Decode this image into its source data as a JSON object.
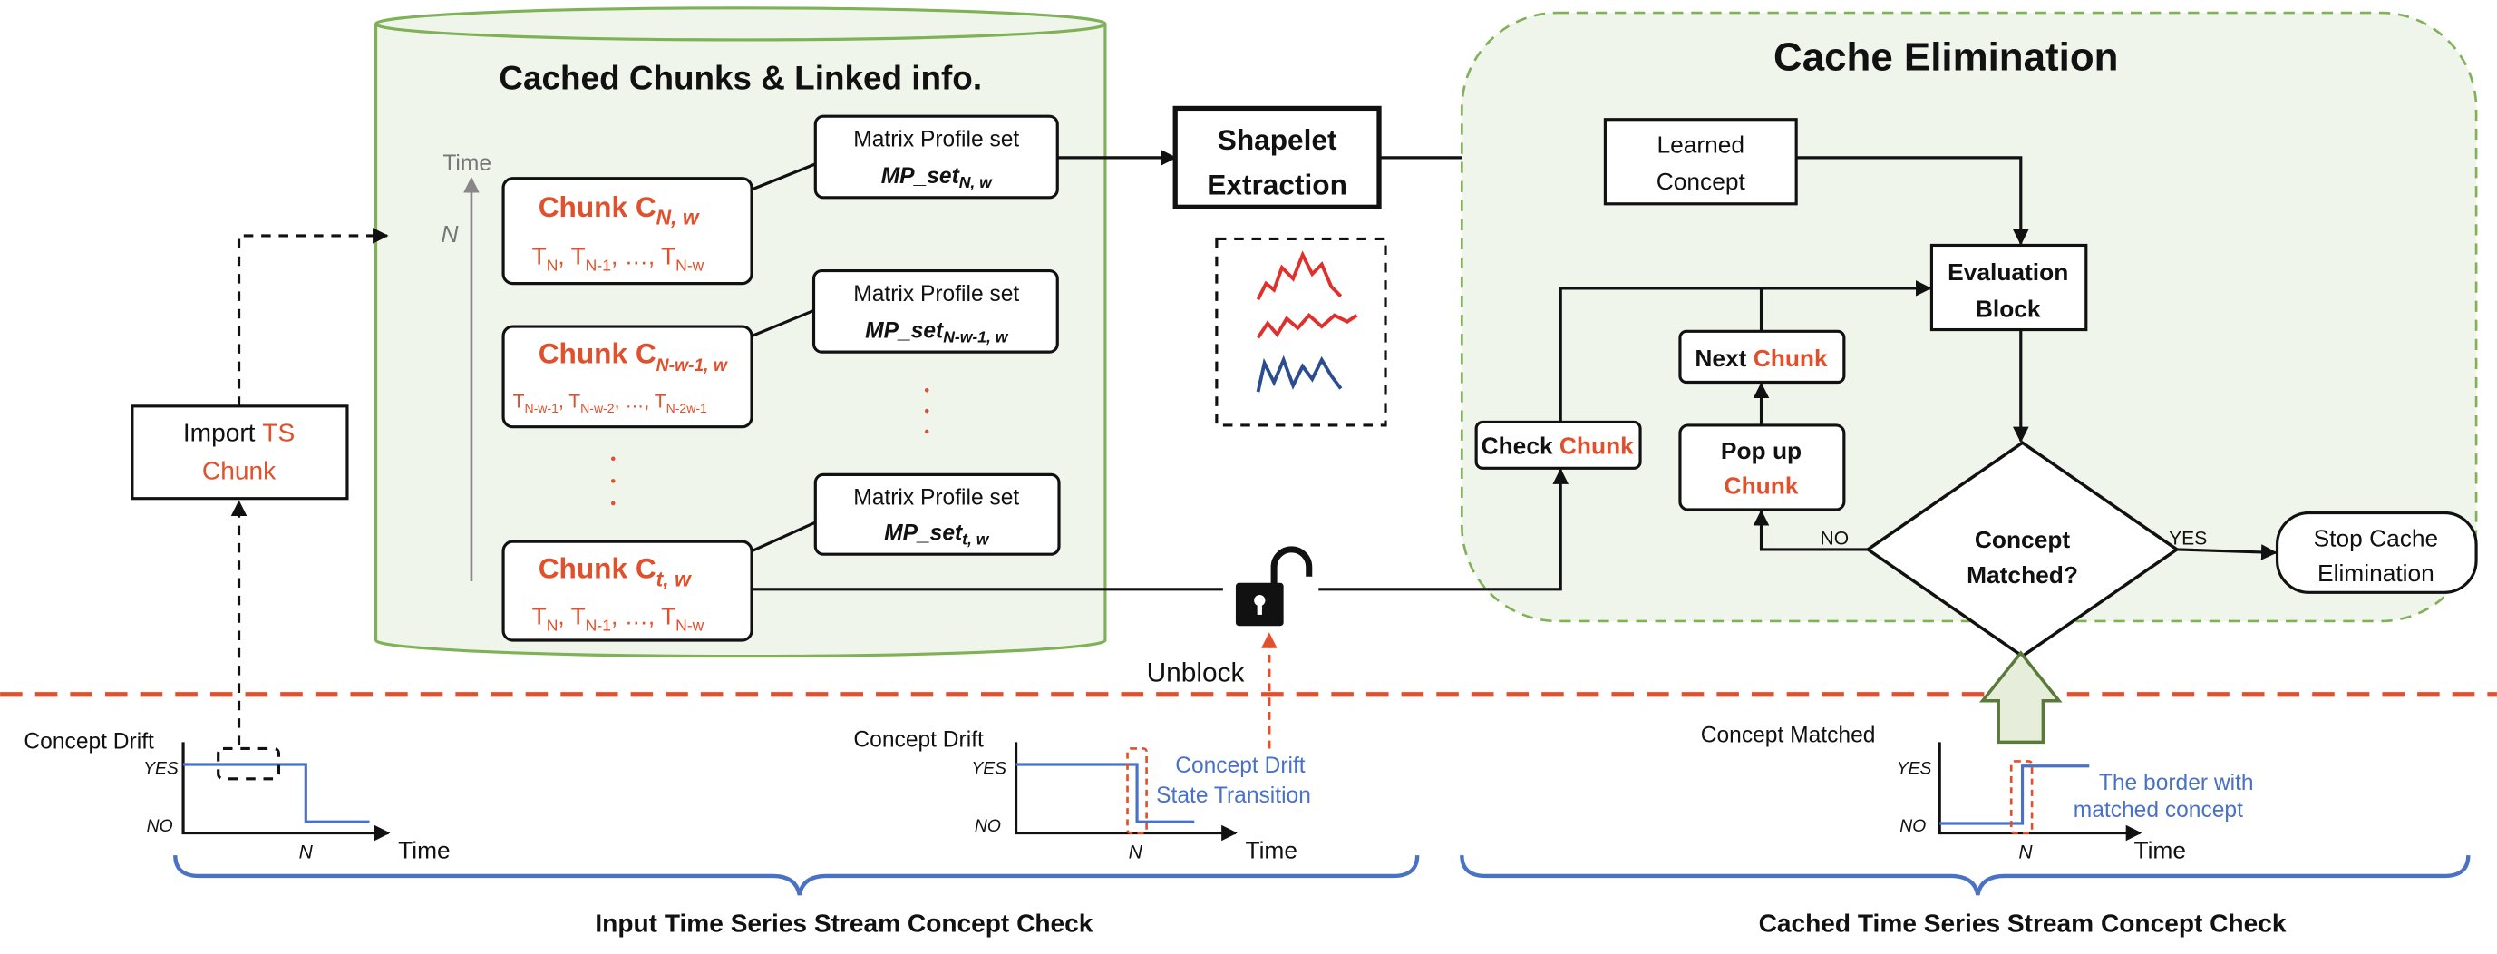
{
  "cache_store": {
    "title": "Cached Chunks & Linked info.",
    "time_axis_label": "Time",
    "n_marker": "N",
    "chunks": [
      {
        "label": "Chunk C",
        "sub": "N, w",
        "series": [
          "T",
          "N",
          ", T",
          "N-1",
          ", …, T",
          "N-w"
        ]
      },
      {
        "label": "Chunk C",
        "sub": "N-w-1, w",
        "series": [
          "T",
          "N-w-1",
          ", T",
          "N-w-2",
          ", …, T",
          "N-2w-1"
        ]
      },
      {
        "label": "Chunk C",
        "sub": "t, w",
        "series": [
          "T",
          "N",
          ", T",
          "N-1",
          ", …, T",
          "N-w"
        ]
      }
    ],
    "matrix_profiles": [
      {
        "label": "Matrix Profile set",
        "name": "MP_set",
        "sub": "N, w"
      },
      {
        "label": "Matrix Profile set",
        "name": "MP_set",
        "sub": "N-w-1, w"
      },
      {
        "label": "Matrix Profile set",
        "name": "MP_set",
        "sub": "t, w"
      }
    ]
  },
  "shapelet": {
    "line1": "Shapelet",
    "line2": "Extraction"
  },
  "import_box": {
    "word1": "Import ",
    "word2": "TS",
    "word3": "Chunk"
  },
  "cache_elimination": {
    "title": "Cache Elimination",
    "learned_concept": [
      "Learned",
      "Concept"
    ],
    "evaluation_block": [
      "Evaluation",
      "Block"
    ],
    "next_chunk": [
      "Next ",
      "Chunk"
    ],
    "check_chunk": [
      "Check ",
      "Chunk"
    ],
    "pop_up_chunk": [
      "Pop up",
      "Chunk"
    ],
    "decision": [
      "Concept",
      "Matched?"
    ],
    "no_label": "NO",
    "yes_label": "YES",
    "stop": [
      "Stop Cache",
      "Elimination"
    ]
  },
  "unblock_label": "Unblock",
  "mini_charts": [
    {
      "ylabel": "Concept Drift",
      "yes": "YES",
      "no": "NO",
      "xtick": "N",
      "xlabel": "Time",
      "transition": "down"
    },
    {
      "ylabel": "Concept Drift",
      "yes": "YES",
      "no": "NO",
      "xtick": "N",
      "xlabel": "Time",
      "transition": "down",
      "note": [
        "Concept Drift",
        "State Transition"
      ]
    },
    {
      "ylabel": "Concept Matched",
      "yes": "YES",
      "no": "NO",
      "xtick": "N",
      "xlabel": "Time",
      "transition": "up",
      "note": [
        "The border with",
        "matched concept"
      ]
    }
  ],
  "sections": {
    "left": "Input  Time Series Stream Concept Check",
    "right": "Cached Time Series Stream Concept Check"
  },
  "colors": {
    "accent_red": "#e0502c",
    "line_blue": "#4a72c4",
    "region_green": "#7fb257",
    "region_fill": "#f0f5ec"
  }
}
